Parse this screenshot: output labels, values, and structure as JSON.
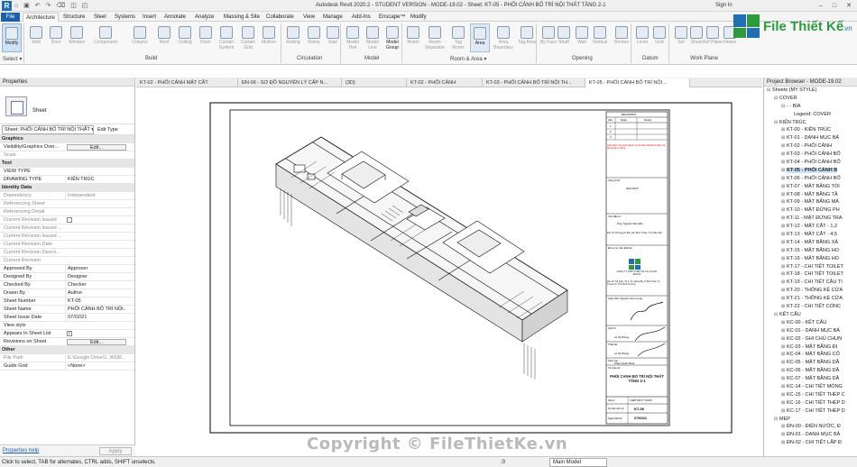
{
  "app": {
    "logo_letter": "R",
    "quick_access": "⌂ ▣ ↶ ↷ ⌫ ◫ ◰",
    "title": "Autodesk Revit 2020.2 - STUDENT VERSION - MODE-19.02 - Sheet: KT-05 - PHỐI CẢNH BỐ TRÍ NỘI THẤT TẦNG 2-1",
    "sign_in": "Sign In"
  },
  "ribbon_tabs": [
    "File",
    "Architecture",
    "Structure",
    "Steel",
    "Systems",
    "Insert",
    "Annotate",
    "Analyze",
    "Massing & Site",
    "Collaborate",
    "View",
    "Manage",
    "Add-Ins",
    "Enscape™",
    "Modify"
  ],
  "ribbon_tools": [
    {
      "label": "Modify"
    },
    {
      "label": "Wall"
    },
    {
      "label": "Door"
    },
    {
      "label": "Window"
    },
    {
      "label": "Component"
    },
    {
      "label": "Column"
    },
    {
      "label": "Roof"
    },
    {
      "label": "Ceiling"
    },
    {
      "label": "Floor"
    },
    {
      "label": "Curtain System"
    },
    {
      "label": "Curtain Grid"
    },
    {
      "label": "Mullion"
    },
    {
      "label": "Railing"
    },
    {
      "label": "Ramp"
    },
    {
      "label": "Stair"
    },
    {
      "label": "Model Text"
    },
    {
      "label": "Model Line"
    },
    {
      "label": "Model Group"
    },
    {
      "label": "Room"
    },
    {
      "label": "Room Separator"
    },
    {
      "label": "Tag Room"
    },
    {
      "label": "Area"
    },
    {
      "label": "Area Boundary"
    },
    {
      "label": "Tag Area"
    },
    {
      "label": "By Face"
    },
    {
      "label": "Shaft"
    },
    {
      "label": "Wall"
    },
    {
      "label": "Vertical"
    },
    {
      "label": "Dormer"
    },
    {
      "label": "Level"
    },
    {
      "label": "Grid"
    },
    {
      "label": "Set"
    },
    {
      "label": "Show"
    },
    {
      "label": "Ref Plane"
    },
    {
      "label": "Viewer"
    }
  ],
  "ribbon_panels": [
    "Select ▾",
    "Build",
    "Circulation",
    "Model",
    "Room & Area ▾",
    "Opening",
    "Datum",
    "Work Plane"
  ],
  "properties": {
    "title": "Properties",
    "type_name": "Sheet",
    "selector": "Sheet: PHỐI CẢNH BỐ TRÍ NỘI THẤT ▾",
    "edit_type": "Edit Type",
    "rows": [
      {
        "k": "Graphics",
        "v": "",
        "kind": "sec"
      },
      {
        "k": "Visibility/Graphics Over...",
        "v": "Edit...",
        "kind": "btn"
      },
      {
        "k": "Scale",
        "v": "",
        "kind": "grey"
      },
      {
        "k": "Text",
        "v": "",
        "kind": "sec"
      },
      {
        "k": "VIEW TYPE",
        "v": "",
        "kind": "row"
      },
      {
        "k": "DRAWING TYPE",
        "v": "KIẾN TRÚC",
        "kind": "row"
      },
      {
        "k": "Identity Data",
        "v": "",
        "kind": "sec"
      },
      {
        "k": "Dependency",
        "v": "Independent",
        "kind": "grey"
      },
      {
        "k": "Referencing Sheet",
        "v": "",
        "kind": "grey"
      },
      {
        "k": "Referencing Detail",
        "v": "",
        "kind": "grey"
      },
      {
        "k": "Current Revision Issued",
        "v": "",
        "kind": "greychk"
      },
      {
        "k": "Current Revision Issued ...",
        "v": "",
        "kind": "grey"
      },
      {
        "k": "Current Revision Issued ...",
        "v": "",
        "kind": "grey"
      },
      {
        "k": "Current Revision Date",
        "v": "",
        "kind": "grey"
      },
      {
        "k": "Current Revision Descri...",
        "v": "",
        "kind": "grey"
      },
      {
        "k": "Current Revision",
        "v": "",
        "kind": "grey"
      },
      {
        "k": "Approved By",
        "v": "Approver",
        "kind": "row"
      },
      {
        "k": "Designed By",
        "v": "Designer",
        "kind": "row"
      },
      {
        "k": "Checked By",
        "v": "Checker",
        "kind": "row"
      },
      {
        "k": "Drawn By",
        "v": "Author",
        "kind": "row"
      },
      {
        "k": "Sheet Number",
        "v": "KT-05",
        "kind": "row"
      },
      {
        "k": "Sheet Name",
        "v": "PHỐI CẢNH BỐ TRÍ NỘI...",
        "kind": "row"
      },
      {
        "k": "Sheet Issue Date",
        "v": "07/02/21",
        "kind": "row"
      },
      {
        "k": "View style",
        "v": "",
        "kind": "row"
      },
      {
        "k": "Appears In Sheet List",
        "v": "✓",
        "kind": "chk"
      },
      {
        "k": "Revisions on Sheet",
        "v": "Edit...",
        "kind": "btn"
      },
      {
        "k": "Other",
        "v": "",
        "kind": "sec"
      },
      {
        "k": "File Path",
        "v": "E:\\Google Drive\\1. WOR...",
        "kind": "grey"
      },
      {
        "k": "Guide Grid",
        "v": "<None>",
        "kind": "row"
      }
    ],
    "help_link": "Properties help",
    "apply": "Apply"
  },
  "view_tabs": [
    {
      "label": "KT-02 - PHỐI CẢNH MẶT CẮT"
    },
    {
      "label": "ĐN-06 - SƠ ĐỒ NGUYÊN LÝ CẤP N..."
    },
    {
      "label": "{3D}"
    },
    {
      "label": "KT-02 - PHỐI CẢNH"
    },
    {
      "label": "KT-03 - PHỐI CẢNH BỐ TRÍ NỘI TH..."
    },
    {
      "label": "KT-05 - PHỐI CẢNH BỐ TRÍ NỘI..."
    }
  ],
  "browser": {
    "title": "Project Browser - MODE-19.02",
    "items": [
      {
        "t": "Sheets (MY STYLE)",
        "lvl": 0,
        "tg": "⊟"
      },
      {
        "t": "COVER",
        "lvl": 1,
        "tg": "⊟"
      },
      {
        "t": "- - BÌA",
        "lvl": 2,
        "tg": "⊟"
      },
      {
        "t": "Legend: COVER",
        "lvl": 3,
        "tg": ""
      },
      {
        "t": "KIẾN TRÚC",
        "lvl": 1,
        "tg": "⊟"
      },
      {
        "t": "KT-00 - KIẾN TRÚC",
        "lvl": 2,
        "tg": "⊞"
      },
      {
        "t": "KT-01 - DANH MỤC BẢ",
        "lvl": 2,
        "tg": "⊞"
      },
      {
        "t": "KT-02 - PHỐI CẢNH",
        "lvl": 2,
        "tg": "⊞"
      },
      {
        "t": "KT-03 - PHỐI CẢNH BỐ",
        "lvl": 2,
        "tg": "⊞"
      },
      {
        "t": "KT-04 - PHỐI CẢNH BỐ",
        "lvl": 2,
        "tg": "⊞"
      },
      {
        "t": "KT-05 - PHỐI CẢNH B",
        "lvl": 2,
        "tg": "⊞",
        "sel": true
      },
      {
        "t": "KT-06 - PHỐI CẢNH BỐ",
        "lvl": 2,
        "tg": "⊞"
      },
      {
        "t": "KT-07 - MẶT BẰNG TỔI",
        "lvl": 2,
        "tg": "⊞"
      },
      {
        "t": "KT-08 - MẶT BẰNG TẦ",
        "lvl": 2,
        "tg": "⊞"
      },
      {
        "t": "KT-09 - MẶT BẰNG MÁ",
        "lvl": 2,
        "tg": "⊞"
      },
      {
        "t": "KT-10 - MẶT ĐỨNG PH",
        "lvl": 2,
        "tg": "⊞"
      },
      {
        "t": "KT-11 - MẶT ĐỨNG TRA",
        "lvl": 2,
        "tg": "⊞"
      },
      {
        "t": "KT-12 - MẶT CẮT - 1,2",
        "lvl": 2,
        "tg": "⊞"
      },
      {
        "t": "KT-13 - MẶT CẮT - 4,5",
        "lvl": 2,
        "tg": "⊞"
      },
      {
        "t": "KT-14 - MẶT BẰNG XÂ",
        "lvl": 2,
        "tg": "⊞"
      },
      {
        "t": "KT-15 - MẶT BẰNG HO",
        "lvl": 2,
        "tg": "⊞"
      },
      {
        "t": "KT-16 - MẶT BẰNG HO",
        "lvl": 2,
        "tg": "⊞"
      },
      {
        "t": "KT-17 - CHI TIẾT TOILET",
        "lvl": 2,
        "tg": "⊞"
      },
      {
        "t": "KT-18 - CHI TIẾT TOILET",
        "lvl": 2,
        "tg": "⊞"
      },
      {
        "t": "KT-19 - CHI TIẾT CẦU TI",
        "lvl": 2,
        "tg": "⊞"
      },
      {
        "t": "KT-20 - THỐNG KÊ CỬA",
        "lvl": 2,
        "tg": "⊞"
      },
      {
        "t": "KT-21 - THỐNG KÊ CỬA",
        "lvl": 2,
        "tg": "⊞"
      },
      {
        "t": "KT-22 - CHI TIẾT CỔNC",
        "lvl": 2,
        "tg": "⊞"
      },
      {
        "t": "KẾT CẤU",
        "lvl": 1,
        "tg": "⊟"
      },
      {
        "t": "KC-00 - KẾT CẤU",
        "lvl": 2,
        "tg": "⊞"
      },
      {
        "t": "KC-01 - DANH MỤC BẢ",
        "lvl": 2,
        "tg": "⊞"
      },
      {
        "t": "KC-02 - GHI CHÚ CHUN",
        "lvl": 2,
        "tg": "⊞"
      },
      {
        "t": "KC-03 - MẶT BẰNG ĐỊ",
        "lvl": 2,
        "tg": "⊞"
      },
      {
        "t": "KC-04 - MẶT BẰNG CỐ",
        "lvl": 2,
        "tg": "⊞"
      },
      {
        "t": "KC-05 - MẶT BẰNG DẦ",
        "lvl": 2,
        "tg": "⊞"
      },
      {
        "t": "KC-06 - MẶT BẰNG DẦ",
        "lvl": 2,
        "tg": "⊞"
      },
      {
        "t": "KC-07 - MẶT BẰNG DẦ",
        "lvl": 2,
        "tg": "⊞"
      },
      {
        "t": "KC-14 - CHI TIẾT MÓNG",
        "lvl": 2,
        "tg": "⊞"
      },
      {
        "t": "KC-15 - CHI TIẾT THÉP C",
        "lvl": 2,
        "tg": "⊞"
      },
      {
        "t": "KC-16 - CHI TIẾT THÉP D",
        "lvl": 2,
        "tg": "⊞"
      },
      {
        "t": "KC-17 - CHI TIẾT THÉP D",
        "lvl": 2,
        "tg": "⊞"
      },
      {
        "t": "MEP",
        "lvl": 1,
        "tg": "⊟"
      },
      {
        "t": "ĐN-00 - ĐIỆN NƯỚC, Đ",
        "lvl": 2,
        "tg": "⊞"
      },
      {
        "t": "ĐN-01 - DANH MỤC BẢ",
        "lvl": 2,
        "tg": "⊞"
      },
      {
        "t": "ĐN-02 - CHI TIẾT LẮP Đ",
        "lvl": 2,
        "tg": "⊞"
      }
    ]
  },
  "titleblock": {
    "revision_header": "REVISIONS",
    "rev_cols": [
      "Lần",
      "Ngày",
      "Duyệt"
    ],
    "rev_nums": [
      "1",
      "2",
      "3"
    ],
    "note_red": "GHI CHÚ: Các kích thước và chi tiết phải được kiểm tra lại tại hiện trường",
    "owner_label": "Công trình:",
    "owner": "NHÀ PHỐ",
    "client_label": "Chủ đầu tư:",
    "client": "Ông: Nguyễn Văn Hiền",
    "addr": "Địa chỉ: 93 Nguyễn Bá Luật, Bình Thuận, Thủ Dầu Một",
    "design_label": "Đơn vị tư vấn thiết kế:",
    "company": "CÔNG TY TNHH THIẾT KẾ XÂY DỰNG ĐHGIẢI",
    "company_addr": "Địa chỉ: Số 1/2A, Tổ 2, Kp. Đông Ba, P. Bình Hòa, Tx. Thuận An, Tỉnh Bình Dương",
    "director_label": "Giám đốc: Nguyễn Hửu Luong",
    "chutri_label": "Chủ trì:",
    "chutri": "Lê Sỹ Khang",
    "design_by": "Thiết kế:",
    "design_name": "Lê Sỹ Khang",
    "check_by": "Kiểm tra:",
    "check_name": "Phạm Quân Khoa",
    "drawing_title_label": "Tên bản vẽ:",
    "drawing_title": "PHỐI CẢNH BỐ TRÍ NỘI THẤT TẦNG 2-1",
    "phase_label": "Hồ sơ:",
    "phase": "THIẾT KẾ KỸ THUẬT",
    "sheet_no_label": "Ký hiệu bản vẽ:",
    "sheet_no": "KT-05",
    "date_label": "Ngày thiết kế:",
    "date": "07/02/21"
  },
  "status": {
    "message": "Click to select, TAB for alternates, CTRL adds, SHIFT unselects.",
    "zero": ":0",
    "model": "Main Model"
  },
  "watermark": {
    "logo_text": "File Thiết Kế",
    "logo_suffix": ".vn",
    "copyright": "Copyright © FileThietKe.vn"
  },
  "colors": {
    "file_tab": "#1d5fa8",
    "selection": "#cde3f7",
    "logo_green": "#2e9a3e",
    "logo_blue": "#1f6fb2"
  }
}
